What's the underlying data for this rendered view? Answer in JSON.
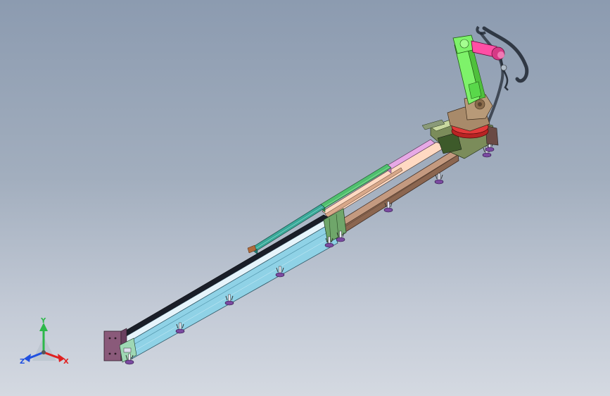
{
  "viewport": {
    "background_top": "#8c9bb0",
    "background_bottom": "#d4d9e1"
  },
  "model": {
    "track_colors": {
      "front_rail": "#8fd2e6",
      "back_rail": "#8b6650",
      "top_strip_green": "#4fbf6e",
      "top_strip_teal": "#3aa898",
      "top_strip_pink": "#e7a9e6",
      "end_plate": "#8a5a7a",
      "robot_arm": "#7ef26a",
      "robot_wrist": "#ff4fa5",
      "robot_base": "#a88a6a",
      "turntable": "#e23a3a"
    }
  },
  "triad": {
    "x_label": "X",
    "y_label": "Y",
    "z_label": "Z",
    "x_color": "#e02020",
    "y_color": "#2db84a",
    "z_color": "#2050e0"
  }
}
